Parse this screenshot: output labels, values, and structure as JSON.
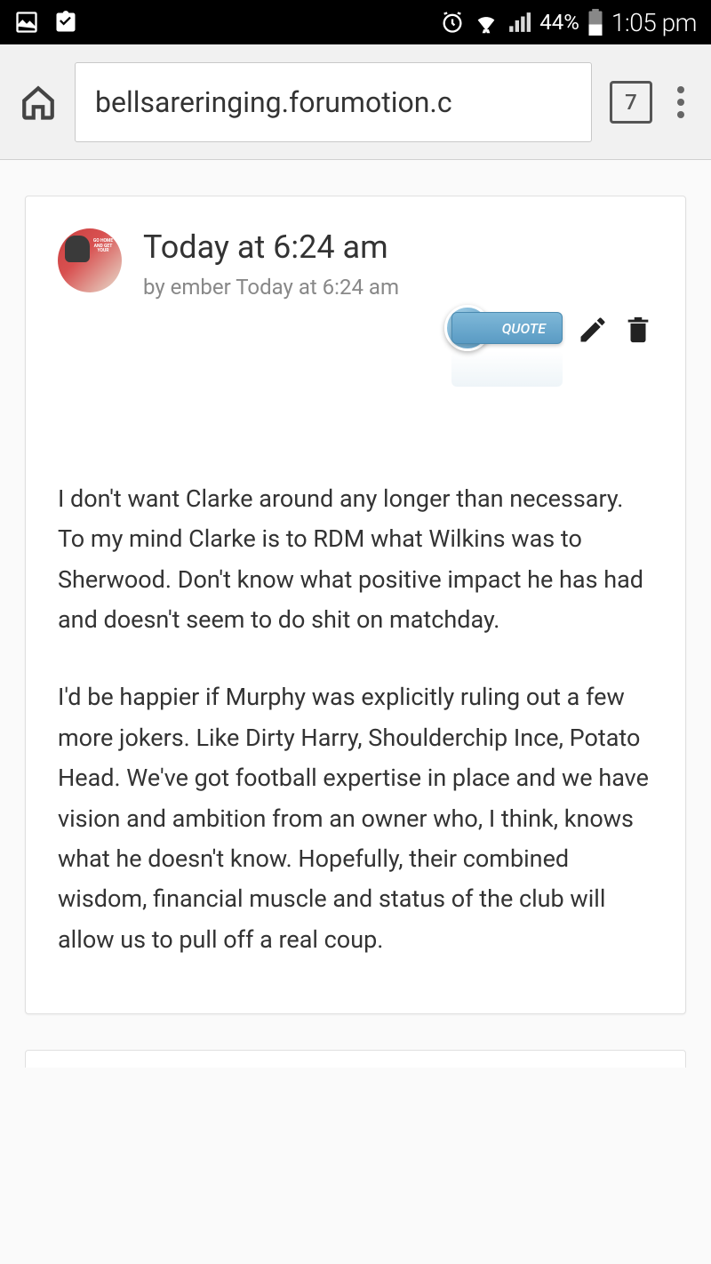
{
  "status_bar": {
    "battery_pct": "44%",
    "time": "1:05 pm"
  },
  "browser": {
    "url_display": "bellsareringing.forumotion.c",
    "tab_count": "7"
  },
  "post": {
    "title": "Today at 6:24 am",
    "meta": "by ember Today at 6:24 am",
    "quote_label": "QUOTE",
    "body_p1": "I don't want Clarke around any longer than necessary. To my mind Clarke is to RDM what Wilkins was to Sherwood. Don't know what positive impact he has had and doesn't seem to do shit on matchday.",
    "body_p2": "I'd be happier if Murphy was explicitly ruling out a few more jokers. Like Dirty Harry, Shoulderchip Ince, Potato Head. We've got football expertise in place and we have vision and ambition from an owner who, I think, knows what he doesn't know. Hopefully, their combined wisdom, financial muscle and status of the club will allow us to pull off a real coup."
  }
}
